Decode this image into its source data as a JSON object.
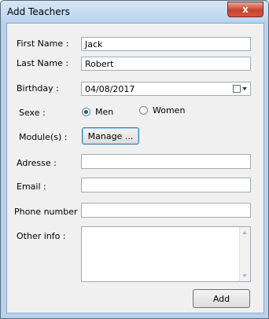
{
  "window": {
    "title": "Add Teachers",
    "close_glyph": "x"
  },
  "form": {
    "first_name": {
      "label": "First Name :",
      "value": "Jack"
    },
    "last_name": {
      "label": "Last Name :",
      "value": "Robert"
    },
    "birthday": {
      "label": "Birthday :",
      "value": "04/08/2017",
      "icon": "calendar-icon"
    },
    "sexe": {
      "label": "Sexe :",
      "options": [
        {
          "label": "Men",
          "selected": true
        },
        {
          "label": "Women",
          "selected": false
        }
      ]
    },
    "modules": {
      "label": "Module(s) :",
      "button_label": "Manage ..."
    },
    "adresse": {
      "label": "Adresse :",
      "value": ""
    },
    "email": {
      "label": "Email :",
      "value": ""
    },
    "phone": {
      "label": "Phone number :",
      "value": ""
    },
    "other_info": {
      "label": "Other info :",
      "value": ""
    }
  },
  "actions": {
    "add_label": "Add"
  }
}
